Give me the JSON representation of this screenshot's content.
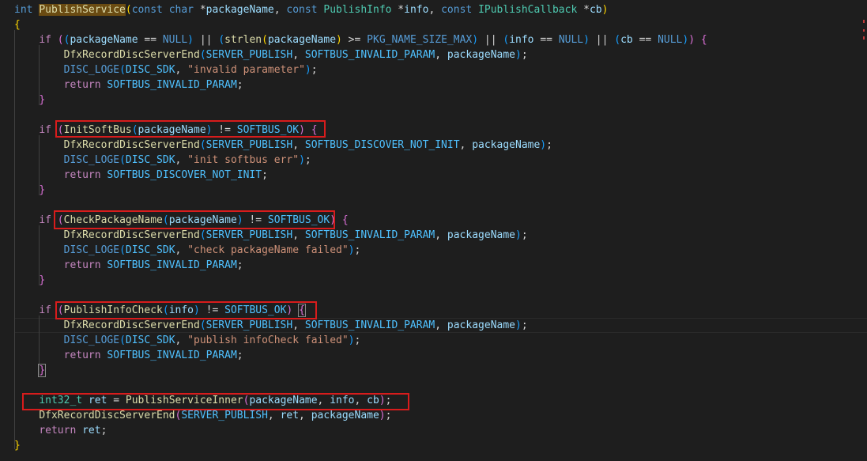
{
  "editor": {
    "lines": [
      [
        [
          "kw",
          "int"
        ],
        [
          "plain",
          " "
        ],
        [
          "hl-fn",
          "PublishService"
        ],
        [
          "p1",
          "("
        ],
        [
          "kw",
          "const"
        ],
        [
          "plain",
          " "
        ],
        [
          "kw",
          "char"
        ],
        [
          "plain",
          " *"
        ],
        [
          "var",
          "packageName"
        ],
        [
          "plain",
          ", "
        ],
        [
          "kw",
          "const"
        ],
        [
          "plain",
          " "
        ],
        [
          "typ",
          "PublishInfo"
        ],
        [
          "plain",
          " *"
        ],
        [
          "var",
          "info"
        ],
        [
          "plain",
          ", "
        ],
        [
          "kw",
          "const"
        ],
        [
          "plain",
          " "
        ],
        [
          "typ",
          "IPublishCallback"
        ],
        [
          "plain",
          " *"
        ],
        [
          "var",
          "cb"
        ],
        [
          "p1",
          ")"
        ]
      ],
      [
        [
          "p1",
          "{"
        ]
      ],
      [
        [
          "plain",
          "    "
        ],
        [
          "ctl",
          "if"
        ],
        [
          "plain",
          " "
        ],
        [
          "p2",
          "("
        ],
        [
          "p3",
          "("
        ],
        [
          "var",
          "packageName"
        ],
        [
          "plain",
          " == "
        ],
        [
          "mac",
          "NULL"
        ],
        [
          "p3",
          ")"
        ],
        [
          "plain",
          " || "
        ],
        [
          "p3",
          "("
        ],
        [
          "fn",
          "strlen"
        ],
        [
          "p1",
          "("
        ],
        [
          "var",
          "packageName"
        ],
        [
          "p1",
          ")"
        ],
        [
          "plain",
          " >= "
        ],
        [
          "mac",
          "PKG_NAME_SIZE_MAX"
        ],
        [
          "p3",
          ")"
        ],
        [
          "plain",
          " || "
        ],
        [
          "p3",
          "("
        ],
        [
          "var",
          "info"
        ],
        [
          "plain",
          " == "
        ],
        [
          "mac",
          "NULL"
        ],
        [
          "p3",
          ")"
        ],
        [
          "plain",
          " || "
        ],
        [
          "p3",
          "("
        ],
        [
          "var",
          "cb"
        ],
        [
          "plain",
          " == "
        ],
        [
          "mac",
          "NULL"
        ],
        [
          "p3",
          ")"
        ],
        [
          "p2",
          ")"
        ],
        [
          "plain",
          " "
        ],
        [
          "p2",
          "{"
        ]
      ],
      [
        [
          "plain",
          "        "
        ],
        [
          "fn",
          "DfxRecordDiscServerEnd"
        ],
        [
          "p3",
          "("
        ],
        [
          "cst",
          "SERVER_PUBLISH"
        ],
        [
          "plain",
          ", "
        ],
        [
          "cst",
          "SOFTBUS_INVALID_PARAM"
        ],
        [
          "plain",
          ", "
        ],
        [
          "var",
          "packageName"
        ],
        [
          "p3",
          ")"
        ],
        [
          "plain",
          ";"
        ]
      ],
      [
        [
          "plain",
          "        "
        ],
        [
          "mac",
          "DISC_LOGE"
        ],
        [
          "p3",
          "("
        ],
        [
          "cst",
          "DISC_SDK"
        ],
        [
          "plain",
          ", "
        ],
        [
          "str",
          "\"invalid parameter\""
        ],
        [
          "p3",
          ")"
        ],
        [
          "plain",
          ";"
        ]
      ],
      [
        [
          "plain",
          "        "
        ],
        [
          "ctl",
          "return"
        ],
        [
          "plain",
          " "
        ],
        [
          "cst",
          "SOFTBUS_INVALID_PARAM"
        ],
        [
          "plain",
          ";"
        ]
      ],
      [
        [
          "plain",
          "    "
        ],
        [
          "p2",
          "}"
        ]
      ],
      [],
      [
        [
          "plain",
          "    "
        ],
        [
          "ctl",
          "if"
        ],
        [
          "plain",
          " "
        ],
        [
          "p2",
          "("
        ],
        [
          "fn",
          "InitSoftBus"
        ],
        [
          "p3",
          "("
        ],
        [
          "var",
          "packageName"
        ],
        [
          "p3",
          ")"
        ],
        [
          "plain",
          " != "
        ],
        [
          "cst",
          "SOFTBUS_OK"
        ],
        [
          "p2",
          ")"
        ],
        [
          "plain",
          " "
        ],
        [
          "p2",
          "{"
        ]
      ],
      [
        [
          "plain",
          "        "
        ],
        [
          "fn",
          "DfxRecordDiscServerEnd"
        ],
        [
          "p3",
          "("
        ],
        [
          "cst",
          "SERVER_PUBLISH"
        ],
        [
          "plain",
          ", "
        ],
        [
          "cst",
          "SOFTBUS_DISCOVER_NOT_INIT"
        ],
        [
          "plain",
          ", "
        ],
        [
          "var",
          "packageName"
        ],
        [
          "p3",
          ")"
        ],
        [
          "plain",
          ";"
        ]
      ],
      [
        [
          "plain",
          "        "
        ],
        [
          "mac",
          "DISC_LOGE"
        ],
        [
          "p3",
          "("
        ],
        [
          "cst",
          "DISC_SDK"
        ],
        [
          "plain",
          ", "
        ],
        [
          "str",
          "\"init softbus err\""
        ],
        [
          "p3",
          ")"
        ],
        [
          "plain",
          ";"
        ]
      ],
      [
        [
          "plain",
          "        "
        ],
        [
          "ctl",
          "return"
        ],
        [
          "plain",
          " "
        ],
        [
          "cst",
          "SOFTBUS_DISCOVER_NOT_INIT"
        ],
        [
          "plain",
          ";"
        ]
      ],
      [
        [
          "plain",
          "    "
        ],
        [
          "p2",
          "}"
        ]
      ],
      [],
      [
        [
          "plain",
          "    "
        ],
        [
          "ctl",
          "if"
        ],
        [
          "plain",
          " "
        ],
        [
          "p2",
          "("
        ],
        [
          "fn",
          "CheckPackageName"
        ],
        [
          "p3",
          "("
        ],
        [
          "var",
          "packageName"
        ],
        [
          "p3",
          ")"
        ],
        [
          "plain",
          " != "
        ],
        [
          "cst",
          "SOFTBUS_OK"
        ],
        [
          "p2",
          ")"
        ],
        [
          "plain",
          " "
        ],
        [
          "p2",
          "{"
        ]
      ],
      [
        [
          "plain",
          "        "
        ],
        [
          "fn",
          "DfxRecordDiscServerEnd"
        ],
        [
          "p3",
          "("
        ],
        [
          "cst",
          "SERVER_PUBLISH"
        ],
        [
          "plain",
          ", "
        ],
        [
          "cst",
          "SOFTBUS_INVALID_PARAM"
        ],
        [
          "plain",
          ", "
        ],
        [
          "var",
          "packageName"
        ],
        [
          "p3",
          ")"
        ],
        [
          "plain",
          ";"
        ]
      ],
      [
        [
          "plain",
          "        "
        ],
        [
          "mac",
          "DISC_LOGE"
        ],
        [
          "p3",
          "("
        ],
        [
          "cst",
          "DISC_SDK"
        ],
        [
          "plain",
          ", "
        ],
        [
          "str",
          "\"check packageName failed\""
        ],
        [
          "p3",
          ")"
        ],
        [
          "plain",
          ";"
        ]
      ],
      [
        [
          "plain",
          "        "
        ],
        [
          "ctl",
          "return"
        ],
        [
          "plain",
          " "
        ],
        [
          "cst",
          "SOFTBUS_INVALID_PARAM"
        ],
        [
          "plain",
          ";"
        ]
      ],
      [
        [
          "plain",
          "    "
        ],
        [
          "p2",
          "}"
        ]
      ],
      [],
      [
        [
          "plain",
          "    "
        ],
        [
          "ctl",
          "if"
        ],
        [
          "plain",
          " "
        ],
        [
          "p2",
          "("
        ],
        [
          "fn",
          "PublishInfoCheck"
        ],
        [
          "p3",
          "("
        ],
        [
          "var",
          "info"
        ],
        [
          "p3",
          ")"
        ],
        [
          "plain",
          " != "
        ],
        [
          "cst",
          "SOFTBUS_OK"
        ],
        [
          "p2",
          ")"
        ],
        [
          "plain",
          " "
        ],
        [
          "p2 brk",
          "{"
        ]
      ],
      [
        [
          "plain",
          "        "
        ],
        [
          "fn",
          "DfxRecordDiscServerEnd"
        ],
        [
          "p3",
          "("
        ],
        [
          "cst",
          "SERVER_PUBLISH"
        ],
        [
          "plain",
          ", "
        ],
        [
          "cst",
          "SOFTBUS_INVALID_PARAM"
        ],
        [
          "plain",
          ", "
        ],
        [
          "var",
          "packageName"
        ],
        [
          "p3",
          ")"
        ],
        [
          "plain",
          ";"
        ]
      ],
      [
        [
          "plain",
          "        "
        ],
        [
          "mac",
          "DISC_LOGE"
        ],
        [
          "p3",
          "("
        ],
        [
          "cst",
          "DISC_SDK"
        ],
        [
          "plain",
          ", "
        ],
        [
          "str",
          "\"publish infoCheck failed\""
        ],
        [
          "p3",
          ")"
        ],
        [
          "plain",
          ";"
        ]
      ],
      [
        [
          "plain",
          "        "
        ],
        [
          "ctl",
          "return"
        ],
        [
          "plain",
          " "
        ],
        [
          "cst",
          "SOFTBUS_INVALID_PARAM"
        ],
        [
          "plain",
          ";"
        ]
      ],
      [
        [
          "plain",
          "    "
        ],
        [
          "p2 brk",
          "}"
        ]
      ],
      [],
      [
        [
          "plain",
          "    "
        ],
        [
          "typ",
          "int32_t"
        ],
        [
          "plain",
          " "
        ],
        [
          "var",
          "ret"
        ],
        [
          "plain",
          " = "
        ],
        [
          "fn",
          "PublishServiceInner"
        ],
        [
          "p2",
          "("
        ],
        [
          "var",
          "packageName"
        ],
        [
          "plain",
          ", "
        ],
        [
          "var",
          "info"
        ],
        [
          "plain",
          ", "
        ],
        [
          "var",
          "cb"
        ],
        [
          "p2",
          ")"
        ],
        [
          "plain",
          ";"
        ]
      ],
      [
        [
          "plain",
          "    "
        ],
        [
          "fn",
          "DfxRecordDiscServerEnd"
        ],
        [
          "p2",
          "("
        ],
        [
          "cst",
          "SERVER_PUBLISH"
        ],
        [
          "plain",
          ", "
        ],
        [
          "var",
          "ret"
        ],
        [
          "plain",
          ", "
        ],
        [
          "var",
          "packageName"
        ],
        [
          "p2",
          ")"
        ],
        [
          "plain",
          ";"
        ]
      ],
      [
        [
          "plain",
          "    "
        ],
        [
          "ctl",
          "return"
        ],
        [
          "plain",
          " "
        ],
        [
          "var",
          "ret"
        ],
        [
          "plain",
          ";"
        ]
      ],
      [
        [
          "p1",
          "}"
        ]
      ]
    ]
  }
}
